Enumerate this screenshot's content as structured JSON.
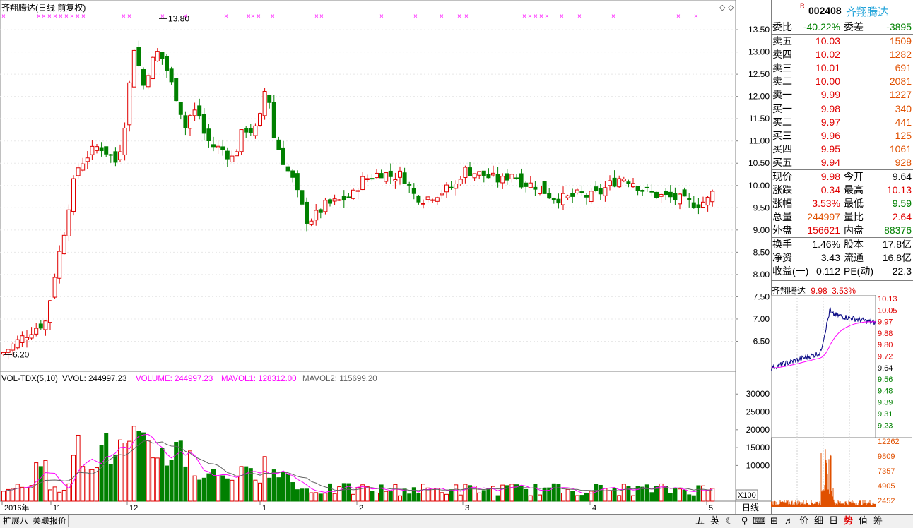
{
  "main_title": "齐翔腾达(日线 前复权)",
  "price_labels": {
    "high": "13.80",
    "low": "6.20"
  },
  "y_axis_price": [
    "13.50",
    "13.00",
    "12.50",
    "12.00",
    "11.50",
    "11.00",
    "10.50",
    "10.00",
    "9.50",
    "9.00",
    "8.50",
    "8.00",
    "7.50",
    "7.00",
    "6.50"
  ],
  "volume_title": {
    "name": "VOL-TDX(5,10)",
    "vvol": "VVOL: 244997.23",
    "volume": "VOLUME: 244997.23",
    "mavol1": "MAVOL1: 128312.00",
    "mavol2": "MAVOL2: 115699.20"
  },
  "y_axis_volume": [
    "30000",
    "25000",
    "20000",
    "15000",
    "10000"
  ],
  "vol_unit": "X100",
  "x_axis": [
    "2016年",
    "11",
    "12",
    "1",
    "2",
    "3",
    "4",
    "5"
  ],
  "period_label": "日线",
  "quote": {
    "r_mark": "R",
    "code": "002408",
    "name": "齐翔腾达",
    "weibi_label": "委比",
    "weibi": "-40.22%",
    "weicha_label": "委差",
    "weicha": "-3895",
    "sell": [
      {
        "label": "卖五",
        "price": "10.03",
        "vol": "1509"
      },
      {
        "label": "卖四",
        "price": "10.02",
        "vol": "1282"
      },
      {
        "label": "卖三",
        "price": "10.01",
        "vol": "691"
      },
      {
        "label": "卖二",
        "price": "10.00",
        "vol": "2081"
      },
      {
        "label": "卖一",
        "price": "9.99",
        "vol": "1227"
      }
    ],
    "buy": [
      {
        "label": "买一",
        "price": "9.98",
        "vol": "340"
      },
      {
        "label": "买二",
        "price": "9.97",
        "vol": "441"
      },
      {
        "label": "买三",
        "price": "9.96",
        "vol": "125"
      },
      {
        "label": "买四",
        "price": "9.95",
        "vol": "1061"
      },
      {
        "label": "买五",
        "price": "9.94",
        "vol": "928"
      }
    ],
    "stats": [
      {
        "l1": "现价",
        "v1": "9.98",
        "c1": "red",
        "l2": "今开",
        "v2": "9.64",
        "c2": "blk"
      },
      {
        "l1": "涨跌",
        "v1": "0.34",
        "c1": "red",
        "l2": "最高",
        "v2": "10.13",
        "c2": "red"
      },
      {
        "l1": "涨幅",
        "v1": "3.53%",
        "c1": "red",
        "l2": "最低",
        "v2": "9.59",
        "c2": "grn"
      },
      {
        "l1": "总量",
        "v1": "244997",
        "c1": "org",
        "l2": "量比",
        "v2": "2.64",
        "c2": "red"
      },
      {
        "l1": "外盘",
        "v1": "156621",
        "c1": "red",
        "l2": "内盘",
        "v2": "88376",
        "c2": "grn"
      }
    ],
    "fin": [
      {
        "l1": "换手",
        "v1": "1.46%",
        "l2": "股本",
        "v2": "17.8亿"
      },
      {
        "l1": "净资",
        "v1": "3.43",
        "l2": "流通",
        "v2": "16.8亿"
      },
      {
        "l1": "收益(一)",
        "v1": "0.112",
        "l2": "PE(动)",
        "v2": "22.3"
      }
    ]
  },
  "mini": {
    "name": "齐翔腾达",
    "price": "9.98",
    "pct": "3.53%",
    "left_ticks": [
      "10.13",
      "10.05",
      "9.97",
      "9.88",
      "9.80",
      "9.72",
      "9.64",
      "9.56",
      "9.48",
      "9.39",
      "9.31",
      "9.23"
    ],
    "vol_ticks": [
      "12262",
      "9809",
      "7357",
      "4905",
      "2452"
    ]
  },
  "bottom_tabs": [
    "扩展八",
    "关联报价"
  ],
  "right_toolbar": [
    "五",
    "英",
    "☾",
    "⚲",
    "⌨",
    "⊞",
    "♬",
    "价",
    "细",
    "日",
    "势",
    "值",
    "筹"
  ],
  "colors": {
    "up": "#e00000",
    "down": "#008000",
    "ma1": "#ff00ff",
    "ma2": "#606060",
    "mini_line": "#000080"
  }
}
